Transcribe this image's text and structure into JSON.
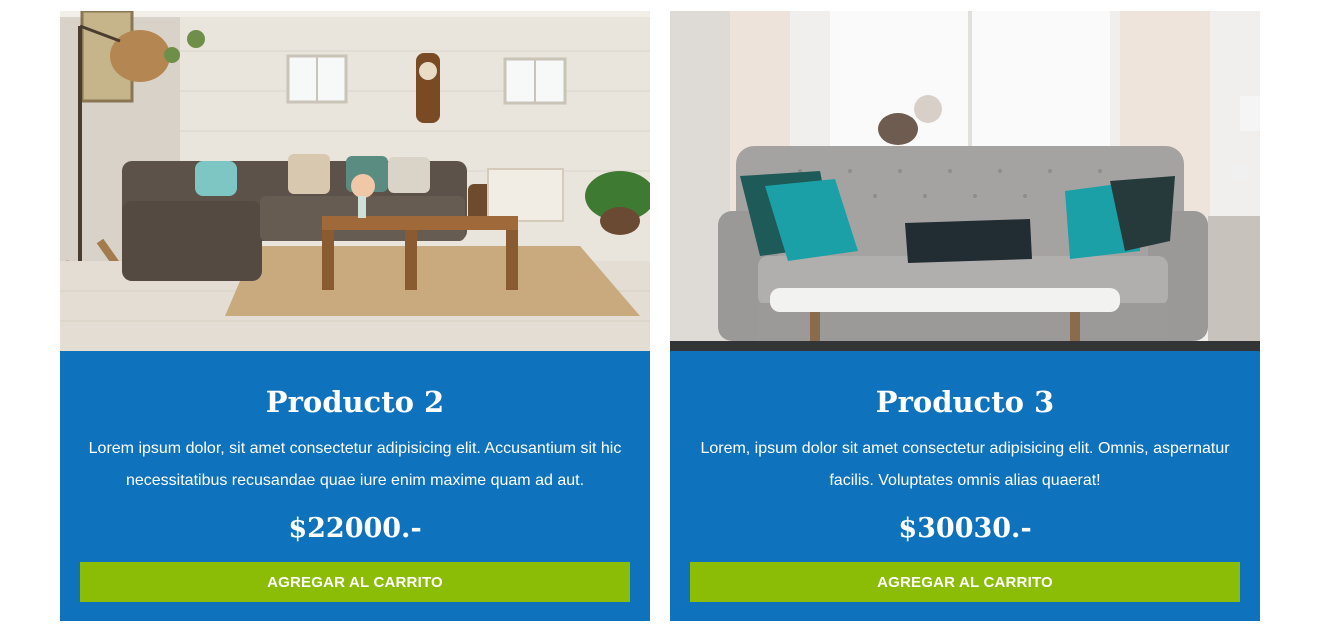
{
  "products": [
    {
      "title": "Producto 2",
      "description": "Lorem ipsum dolor, sit amet consectetur adipisicing elit. Accusantium sit hic necessitatibus recusandae quae iure enim maxime quam ad aut.",
      "price": "$22000.-",
      "button_label": "AGREGAR AL CARRITO",
      "image": "living-room-photo"
    },
    {
      "title": "Producto 3",
      "description": "Lorem, ipsum dolor sit amet consectetur adipisicing elit. Omnis, aspernatur facilis. Voluptates omnis alias quaerat!",
      "price": "$30030.-",
      "button_label": "AGREGAR AL CARRITO",
      "image": "sofa-photo"
    }
  ],
  "colors": {
    "card_background": "#0f72bc",
    "button_background": "#8bbd07",
    "text": "#ffffff"
  }
}
